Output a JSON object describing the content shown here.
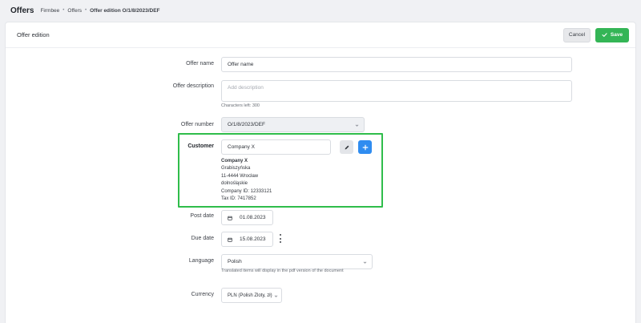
{
  "header": {
    "app_title": "Offers",
    "breadcrumb": [
      "Firmbee",
      "Offers",
      "Offer edition O/1/8/2023/DEF"
    ]
  },
  "card": {
    "title": "Offer edition",
    "cancel_label": "Cancel",
    "save_label": "Save"
  },
  "form": {
    "offer_name": {
      "label": "Offer name",
      "value": "Offer name"
    },
    "offer_description": {
      "label": "Offer description",
      "placeholder": "Add description",
      "hint": "Characters left: 300"
    },
    "offer_number": {
      "label": "Offer number",
      "value": "O/1/8/2023/DEF"
    },
    "customer": {
      "label": "Customer",
      "value": "Company X",
      "details": {
        "name": "Company X",
        "street": "Grabiszyńska",
        "postal_city": "11-4444  Wrocław",
        "region": "dolnośląskie",
        "company_id": "Company ID: 12333121",
        "tax_id": "Tax ID: 7417852"
      }
    },
    "post_date": {
      "label": "Post date",
      "value": "01.08.2023"
    },
    "due_date": {
      "label": "Due date",
      "value": "15.08.2023"
    },
    "language": {
      "label": "Language",
      "value": "Polish",
      "hint": "Translated items will display in the pdf version of the document"
    },
    "currency": {
      "label": "Currency",
      "value": "PLN (Polish Zloty, zł)"
    }
  },
  "colors": {
    "save_green": "#34b556",
    "highlight_green": "#2fbd4b",
    "add_blue": "#2f8cf0"
  }
}
